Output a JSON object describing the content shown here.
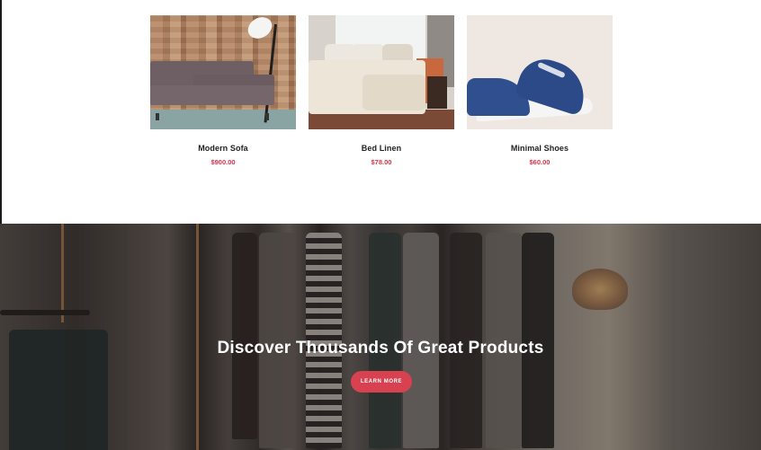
{
  "products": [
    {
      "name": "Modern Sofa",
      "price": "$900.00",
      "image_icon": "sofa-photo"
    },
    {
      "name": "Bed Linen",
      "price": "$78.00",
      "image_icon": "bed-photo"
    },
    {
      "name": "Minimal Shoes",
      "price": "$60.00",
      "image_icon": "shoes-photo"
    }
  ],
  "hero": {
    "title": "Discover Thousands Of Great Products",
    "button_label": "LEARN MORE"
  },
  "colors": {
    "accent": "#d8414f",
    "price": "#d8334a",
    "title": "#222222"
  }
}
